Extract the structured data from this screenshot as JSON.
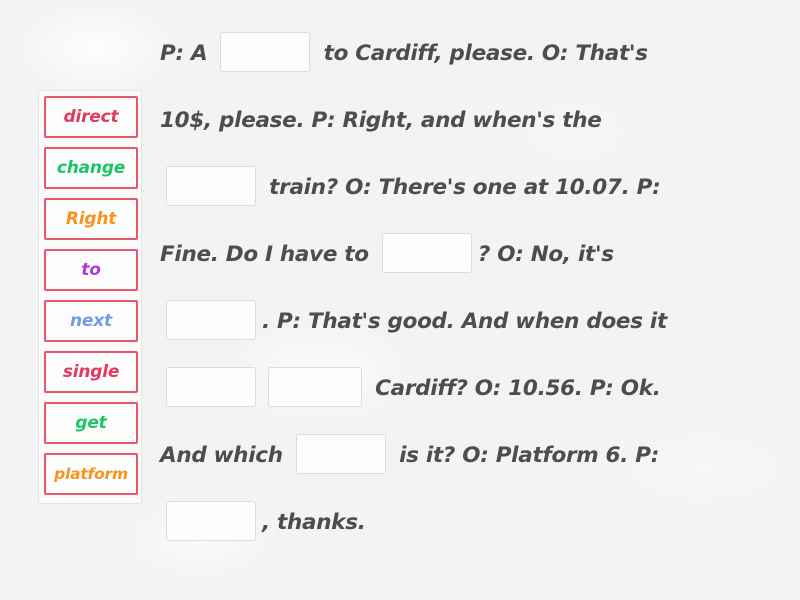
{
  "activity": {
    "type": "drag-and-drop-gap-fill",
    "background_color": "#f3f3f4"
  },
  "tray": {
    "name": "word-bank",
    "border_color": "#e8556e",
    "tiles": [
      {
        "label": "direct",
        "color": "#e03a5f"
      },
      {
        "label": "change",
        "color": "#1ec46a"
      },
      {
        "label": "Right",
        "color": "#f5941e"
      },
      {
        "label": "to",
        "color": "#b43ad8"
      },
      {
        "label": "next",
        "color": "#6f9de8"
      },
      {
        "label": "single",
        "color": "#e03a5f"
      },
      {
        "label": "get",
        "color": "#1ec46a"
      },
      {
        "label": "platform",
        "color": "#f5941e"
      }
    ]
  },
  "sentence": {
    "text_color": "#4d4d4d",
    "lines": [
      {
        "segments": [
          {
            "type": "text",
            "value": "P: A "
          },
          {
            "type": "blank",
            "index": 1
          },
          {
            "type": "text",
            "value": " to Cardiff, please. O: That's"
          }
        ]
      },
      {
        "segments": [
          {
            "type": "text",
            "value": "10$, please. P: Right, and when's the"
          }
        ]
      },
      {
        "segments": [
          {
            "type": "blank",
            "index": 2
          },
          {
            "type": "text",
            "value": " train? O: There's one at 10.07. P:"
          }
        ]
      },
      {
        "segments": [
          {
            "type": "text",
            "value": "Fine. Do I have to "
          },
          {
            "type": "blank",
            "index": 3
          },
          {
            "type": "text",
            "value": "? O: No, it's"
          }
        ]
      },
      {
        "segments": [
          {
            "type": "blank",
            "index": 4
          },
          {
            "type": "text",
            "value": ". P: That's good. And when does it"
          }
        ]
      },
      {
        "segments": [
          {
            "type": "blank",
            "index": 5
          },
          {
            "type": "blank",
            "index": 6
          },
          {
            "type": "text",
            "value": " Cardiff? O: 10.56. P: Ok."
          }
        ]
      },
      {
        "segments": [
          {
            "type": "text",
            "value": "And which "
          },
          {
            "type": "blank",
            "index": 7
          },
          {
            "type": "text",
            "value": " is it? O: Platform 6. P:"
          }
        ]
      },
      {
        "segments": [
          {
            "type": "blank",
            "index": 8
          },
          {
            "type": "text",
            "value": ", thanks."
          }
        ]
      }
    ]
  }
}
